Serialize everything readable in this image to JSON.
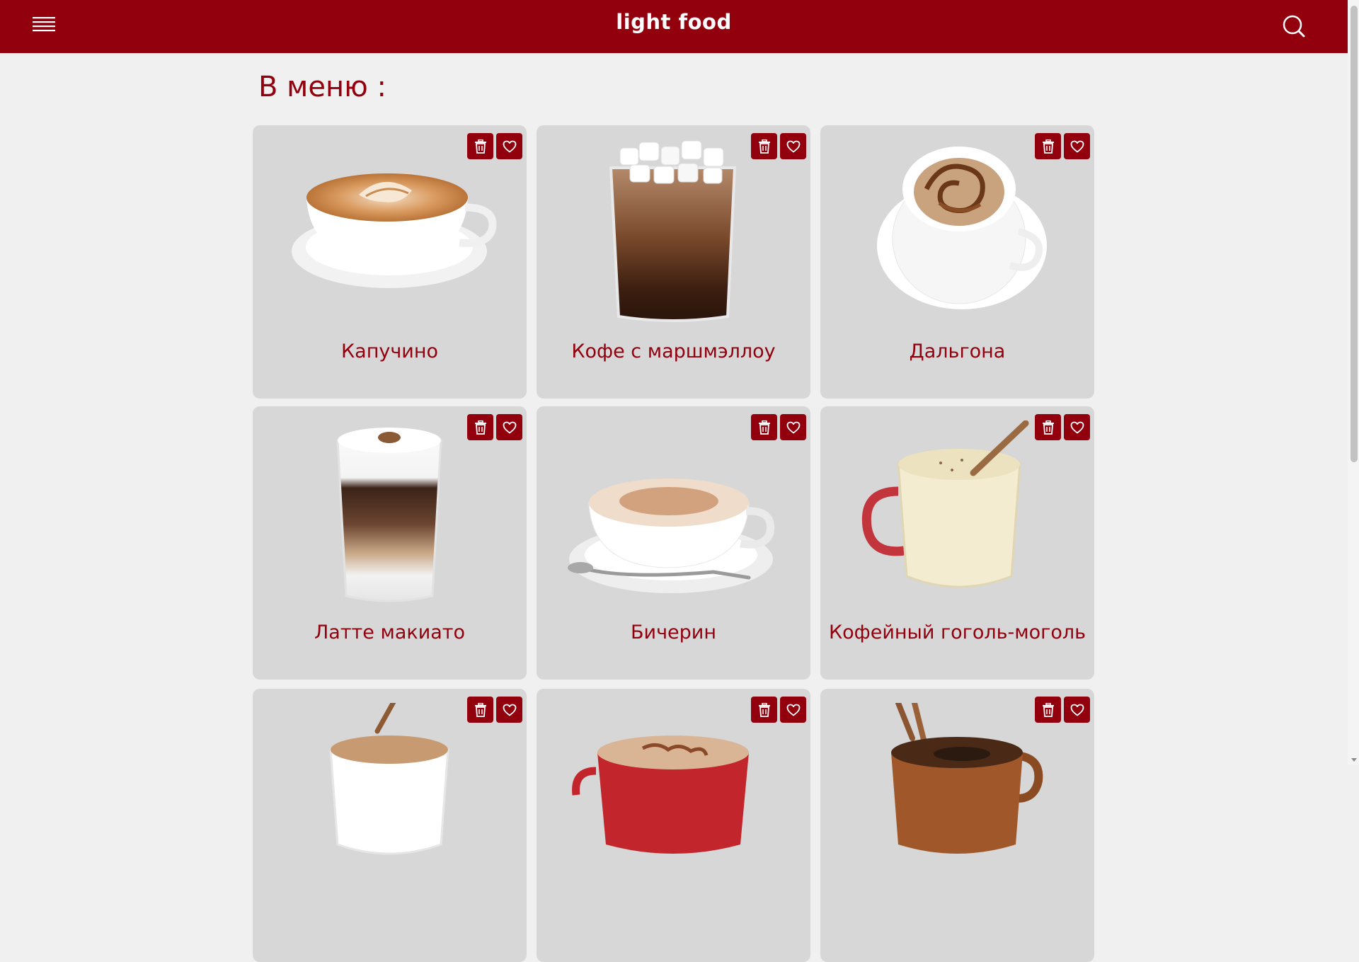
{
  "header": {
    "brand": "light food",
    "menu_icon": "hamburger-menu-icon",
    "search_icon": "search-icon",
    "background_color": "#92000e"
  },
  "main": {
    "title": "В меню :"
  },
  "card_actions": {
    "delete_icon": "trash-icon",
    "favorite_icon": "heart-icon"
  },
  "menu_items": [
    {
      "name": "Капучино",
      "image": "cappuccino-cup"
    },
    {
      "name": "Кофе с маршмэллоу",
      "image": "marshmallow-cocoa-glass"
    },
    {
      "name": "Дальгона",
      "image": "dalgona-cup"
    },
    {
      "name": "Латте макиато",
      "image": "latte-macchiato-glass"
    },
    {
      "name": "Бичерин",
      "image": "bicerin-cup"
    },
    {
      "name": "Кофейный гоголь-моголь",
      "image": "eggnog-mug"
    },
    {
      "name": "",
      "image": "cinnamon-coffee-cup"
    },
    {
      "name": "",
      "image": "red-cocoa-mug"
    },
    {
      "name": "",
      "image": "clay-mug-cinnamon"
    }
  ]
}
